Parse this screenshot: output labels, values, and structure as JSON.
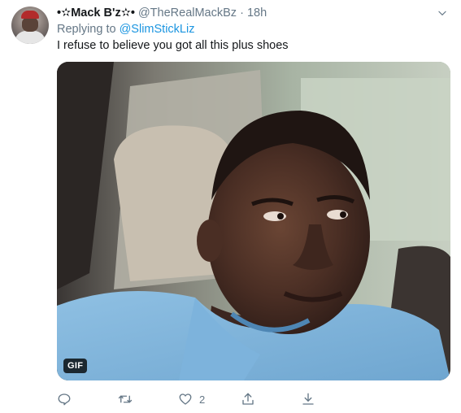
{
  "tweet": {
    "display_name": "•✫Mack B'z✫•",
    "handle": "@TheRealMackBz",
    "separator": "·",
    "time": "18h",
    "replying_prefix": "Replying to",
    "replying_to": "@SlimStickLiz",
    "text": "I refuse to believe you got all this plus shoes",
    "media": {
      "badge": "GIF"
    },
    "actions": {
      "reply_icon": "reply-icon",
      "retweet_icon": "retweet-icon",
      "like_icon": "heart-icon",
      "like_count": "2",
      "share_icon": "share-icon",
      "download_icon": "download-icon"
    }
  },
  "colors": {
    "text": "#14171a",
    "secondary": "#657786",
    "link": "#1b95e0"
  }
}
